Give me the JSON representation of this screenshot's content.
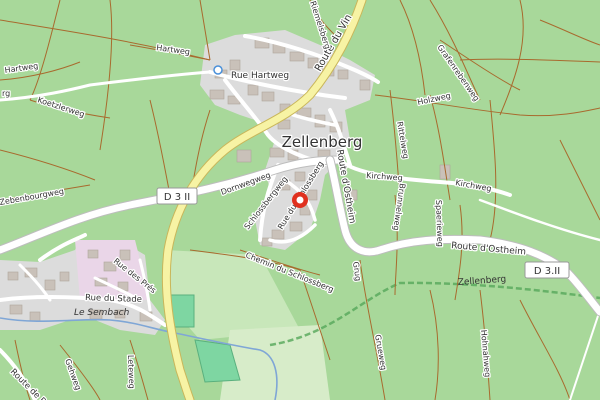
{
  "map": {
    "place": "Zellenberg",
    "roads": {
      "route_du_vin": "Route du Vin",
      "d3ii_left": "D 3 II",
      "d3ii_right": "D 3.II",
      "route_dostheim_east": "Route d'Ostheim",
      "route_dostheim_vertical": "Route d'Ostheim",
      "rue_hartweg": "Rue Hartweg",
      "hartweg_top": "Hartweg",
      "hartweg_left": "Hartweg",
      "rue_du_stade": "Rue du Stade",
      "rue_des_pres": "Rue des Prés",
      "route_de_ro": "Route de Ro",
      "riemelsberg": "Riemelsberg",
      "grafenreben": "Grafenrebenweg",
      "holzweg": "Holzweg",
      "kirchweg_mid": "Kirchweg",
      "kirchweg_east": "Kirchweg",
      "rittelweg": "Rittelweg",
      "brunnelweg": "Brunnelweg",
      "spaerieweg": "Spaerieweg",
      "dornwegweg": "Dornwegweg",
      "schlossbergweg": "Schlossbergweg",
      "chemin_du_schlossberg": "Chemin du Schlossberg",
      "rue_du_schlossberg": "Rue du Schlossberg",
      "koetzlerweg": "Koetzlerweg",
      "zebenbourgweg": "Zebenbourgweg",
      "grug": "Grug",
      "grueweg": "Grueweg",
      "hohnahweg": "Hohnahweg",
      "gehweg": "Gehweg",
      "leteweg": "Leteweg",
      "rg_fragment": "rg",
      "zellenberg_track": "Zellenberg"
    },
    "water": {
      "le_sembach": "Le Sembach"
    },
    "colors": {
      "vineyard": "#a8d89a",
      "vineyard_light": "#c8e7ba",
      "residential": "#dcdcdc",
      "building": "#c9c1b9",
      "main_road": "#f7f3a4",
      "main_road_casing": "#c9b65a",
      "track": "#a86a2e",
      "marker": "#e0301e",
      "river": "#7fa6d6",
      "pitch": "#7ed6a2",
      "railway": "#55a85a"
    },
    "marker_icon": "map-pin-icon"
  }
}
